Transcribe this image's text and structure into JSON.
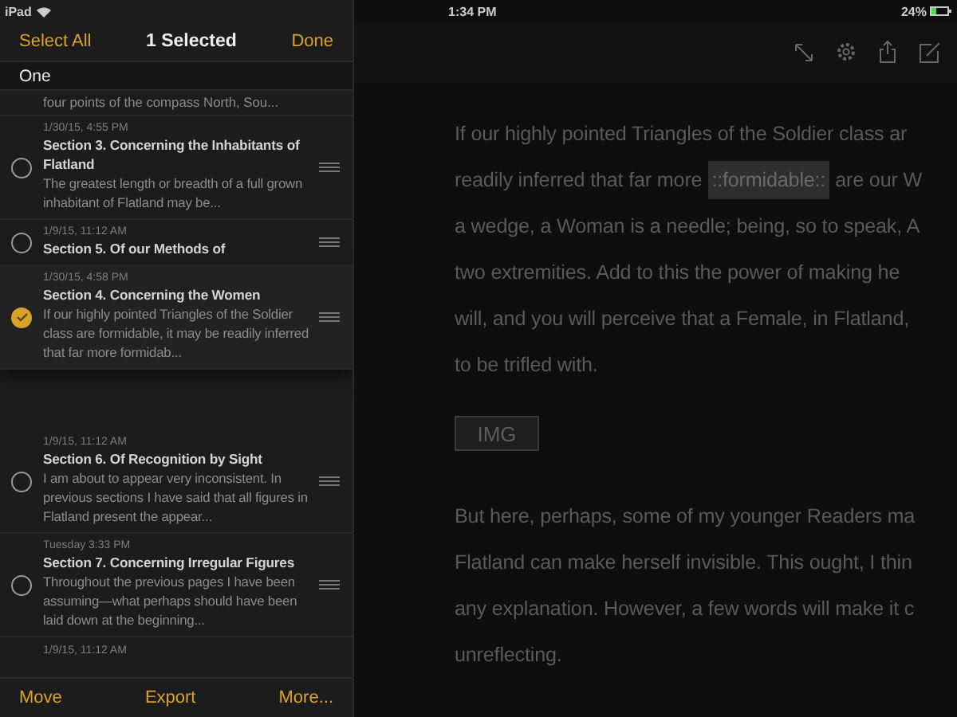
{
  "status_bar": {
    "device": "iPad",
    "time": "1:34 PM",
    "battery": "24%"
  },
  "sidebar": {
    "header": {
      "left": "Select All",
      "title": "1 Selected",
      "right": "Done"
    },
    "group": "One",
    "notes": [
      {
        "kind": "snippet",
        "preview": "four points of the compass North, Sou..."
      },
      {
        "kind": "note",
        "date": "1/30/15, 4:55 PM",
        "title": "Section 3. Concerning the Inhabitants of Flatland",
        "preview": "The greatest length or breadth of a full grown inhabitant of Flatland may be...",
        "selected": false
      },
      {
        "kind": "note",
        "date": "1/9/15, 11:12 AM",
        "title": "Section 5. Of our Methods of",
        "selected": false
      },
      {
        "kind": "dragged",
        "date": "1/30/15, 4:58 PM",
        "title": "Section 4. Concerning the Women",
        "preview": "If our highly pointed Triangles of the Soldier class are formidable, it may be readily inferred that far more formidab...",
        "selected": true
      },
      {
        "kind": "note",
        "date": "1/9/15, 11:12 AM",
        "title": "Section 6. Of Recognition by Sight",
        "preview": "I am about to appear very inconsistent. In previous sections I have said that all figures in Flatland present the appear...",
        "selected": false
      },
      {
        "kind": "note",
        "date": "Tuesday 3:33 PM",
        "title": "Section 7. Concerning Irregular Figures",
        "preview": "Throughout the previous pages I have been assuming—what perhaps should have been laid down at the beginning...",
        "selected": false
      },
      {
        "kind": "stub",
        "date": "1/9/15, 11:12 AM"
      }
    ],
    "footer": [
      "Move",
      "Export",
      "More..."
    ]
  },
  "editor": {
    "blocks": [
      {
        "kind": "line",
        "parts": [
          {
            "text": "If our highly pointed Triangles of the Soldier class ar",
            "highlight": false
          }
        ]
      },
      {
        "kind": "line",
        "parts": [
          {
            "text": "readily inferred that far more",
            "highlight": false
          },
          {
            "text": "::formidable::",
            "highlight": true
          },
          {
            "text": "are our W",
            "highlight": false
          }
        ]
      },
      {
        "kind": "line",
        "parts": [
          {
            "text": "a wedge, a Woman is a needle; being, so to speak, A",
            "highlight": false
          }
        ]
      },
      {
        "kind": "line",
        "parts": [
          {
            "text": "two extremities. Add to this the power of making he",
            "highlight": false
          }
        ]
      },
      {
        "kind": "line",
        "parts": [
          {
            "text": "will, and you will perceive that a Female, in Flatland,",
            "highlight": false
          }
        ]
      },
      {
        "kind": "line",
        "parts": [
          {
            "text": "to be trifled with.",
            "highlight": false
          }
        ]
      },
      {
        "kind": "tag",
        "text": "IMG"
      },
      {
        "kind": "line",
        "parts": [
          {
            "text": "But here, perhaps, some of my younger Readers ma",
            "highlight": false
          }
        ]
      },
      {
        "kind": "line",
        "parts": [
          {
            "text": "Flatland can make herself invisible. This ought, I thin",
            "highlight": false
          }
        ]
      },
      {
        "kind": "line",
        "parts": [
          {
            "text": "any explanation. However, a few words will make it c",
            "highlight": false
          }
        ]
      },
      {
        "kind": "line",
        "parts": [
          {
            "text": "unreflecting.",
            "highlight": false
          }
        ]
      }
    ]
  }
}
